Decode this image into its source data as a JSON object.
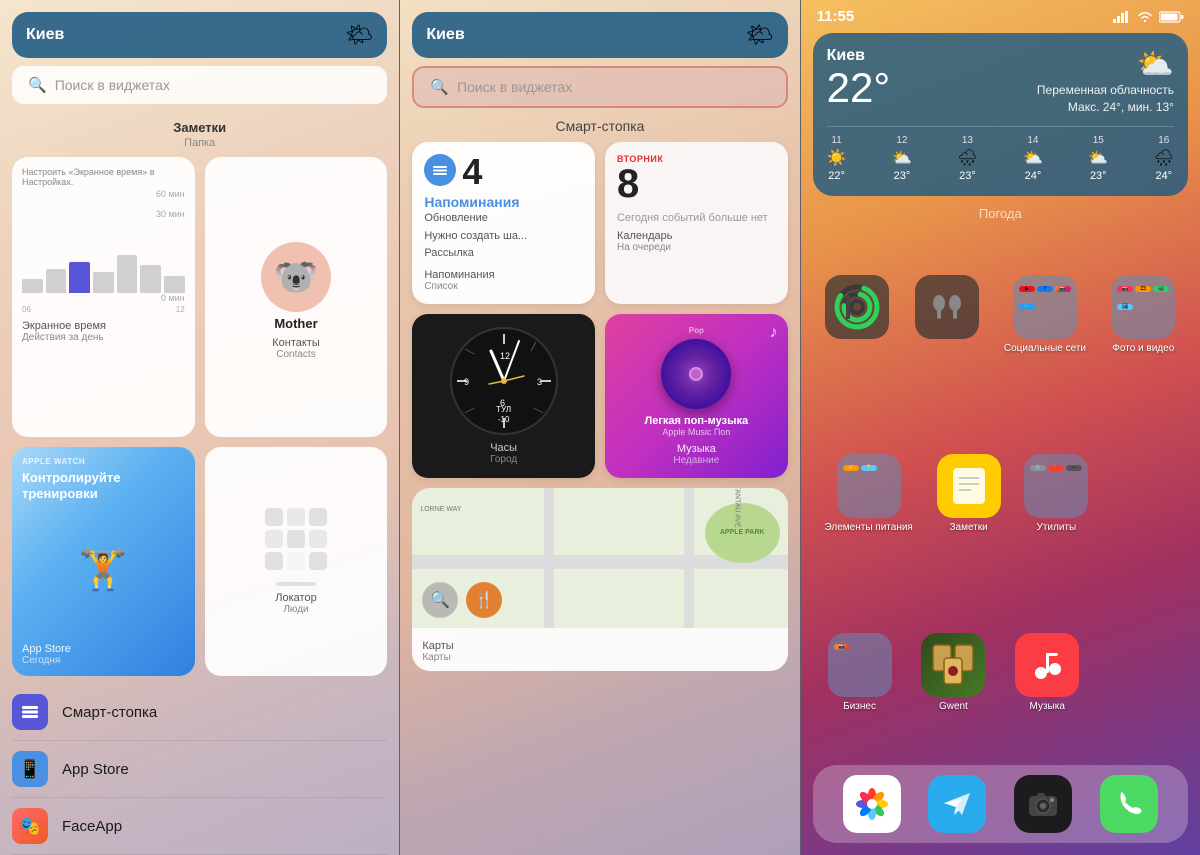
{
  "panel1": {
    "weather_city": "Киев",
    "weather_icon": "🌤",
    "search_placeholder": "🔍  Поиск в виджетах",
    "notes_title": "Заметки",
    "notes_sub": "Папка",
    "screen_time_title": "Настроить «Экранное время» в Настройках.",
    "screen_time_duration": "60 мин",
    "screen_time_mid": "30 мин",
    "screen_time_bot": "0 мин",
    "screen_time_label1": "06",
    "screen_time_label2": "12",
    "contact_name": "Mother",
    "widget_screen_label": "Экранное время",
    "widget_screen_sub": "Действия за день",
    "widget_contacts_label": "Контакты",
    "widget_contacts_sub": "Contacts",
    "widget_appstore_tag": "APPLE WATCH",
    "widget_appstore_title": "Контролируйте тренировки",
    "widget_appstore_label": "App Store",
    "widget_appstore_sub": "Сегодня",
    "widget_locator_label": "Локатор",
    "widget_locator_sub": "Люди",
    "list_items": [
      {
        "icon": "🗂",
        "bg": "#5856d6",
        "label": "Смарт-стопка"
      },
      {
        "icon": "📱",
        "bg": "#4a90e2",
        "label": "App Store"
      },
      {
        "icon": "🎭",
        "bg": "#ff2d55",
        "label": "FaceApp"
      }
    ]
  },
  "panel2": {
    "weather_city": "Киев",
    "weather_icon": "🌤",
    "search_placeholder": "🔍  Поиск в виджетах",
    "stack_label": "Смарт-стопка",
    "reminders_icon": "≡",
    "reminders_count": "4",
    "reminders_title": "Напоминания",
    "reminders_sub1": "Обновление",
    "reminders_sub2": "Нужно создать ша...",
    "reminders_sub3": "Рассылка",
    "reminders_label": "Напоминания",
    "reminders_section": "Список",
    "calendar_day": "ВТОРНИК",
    "calendar_date": "8",
    "calendar_empty": "Сегодня событий больше нет",
    "calendar_label": "Календарь",
    "calendar_section": "На очереди",
    "clock_label": "Часы",
    "clock_section": "Город",
    "clock_sublabel": "ТУЛ",
    "clock_neg": "-10",
    "music_title": "Легкая поп-музыка",
    "music_sub": "Apple Music Поп",
    "music_tag": "Pop",
    "music_label": "Музыка",
    "music_section": "Недавние",
    "maps_label": "Карты",
    "maps_section": "Карты",
    "maps_park": "APPLE PARK"
  },
  "panel3": {
    "time": "11:55",
    "status_icons": "▲ ▲▲ ▲ 🔋",
    "weather_city": "Киев",
    "weather_temp": "22°",
    "weather_desc": "Переменная облачность",
    "weather_desc2": "Макс. 24°, мин. 13°",
    "forecast": [
      {
        "day": "11",
        "icon": "☀️",
        "temp": "22°"
      },
      {
        "day": "12",
        "icon": "⛅",
        "temp": "23°"
      },
      {
        "day": "13",
        "icon": "🌧",
        "temp": "23°"
      },
      {
        "day": "14",
        "icon": "⛅",
        "temp": "24°"
      },
      {
        "day": "15",
        "icon": "⛅",
        "temp": "23°"
      },
      {
        "day": "16",
        "icon": "🌧",
        "temp": "24°"
      }
    ],
    "weather_widget_label": "Погода",
    "row1": [
      {
        "icon": "📱",
        "bg": "#444",
        "label": ""
      },
      {
        "icon": "🎵",
        "bg": "#444",
        "label": ""
      },
      {
        "icon": "",
        "bg": "folder_social",
        "label": "Социальные сети"
      },
      {
        "icon": "",
        "bg": "folder_photo",
        "label": "Фото и видео"
      }
    ],
    "row2": [
      {
        "icon": "",
        "bg": "folder_power",
        "label": "Элементы питания"
      },
      {
        "icon": "📝",
        "bg": "#ffcc00",
        "label": "Заметки"
      },
      {
        "icon": "",
        "bg": "folder_utils",
        "label": "Утилиты"
      }
    ],
    "row3": [
      {
        "icon": "",
        "bg": "folder_biz",
        "label": "Бизнес"
      },
      {
        "icon": "",
        "bg": "gwent",
        "label": "Gwent"
      },
      {
        "icon": "🎵",
        "bg": "#fc3c44",
        "label": "Музыка"
      }
    ],
    "dock": [
      {
        "icon": "🌸",
        "bg": "#fff",
        "label": "Photos"
      },
      {
        "icon": "✈️",
        "bg": "#2aabee",
        "label": "Telegram"
      },
      {
        "icon": "📷",
        "bg": "#222",
        "label": "Camera"
      },
      {
        "icon": "📞",
        "bg": "#4cd964",
        "label": "Phone"
      }
    ]
  }
}
